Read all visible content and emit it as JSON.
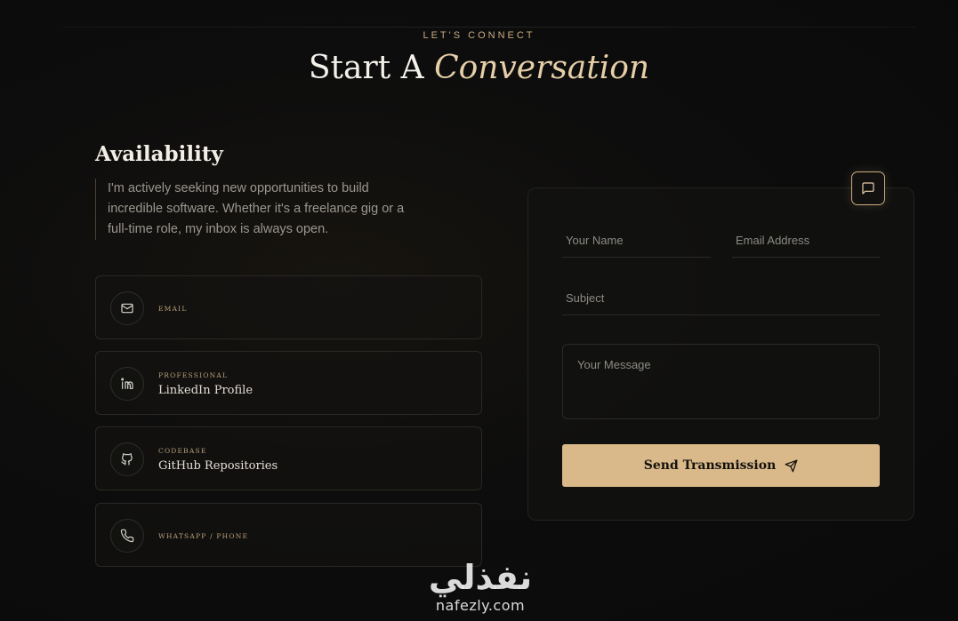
{
  "header": {
    "eyebrow": "LET'S CONNECT",
    "title_main": "Start A",
    "title_accent": "Conversation"
  },
  "availability": {
    "title": "Availability",
    "text": "I'm actively seeking new opportunities to build incredible software. Whether it's a freelance gig or a full-time role, my inbox is always open."
  },
  "contacts": [
    {
      "type": "EMAIL",
      "value": "",
      "icon": "mail-icon"
    },
    {
      "type": "PROFESSIONAL",
      "value": "LinkedIn Profile",
      "icon": "linkedin-icon"
    },
    {
      "type": "CODEBASE",
      "value": "GitHub Repositories",
      "icon": "github-icon"
    },
    {
      "type": "WHATSAPP / PHONE",
      "value": "",
      "icon": "phone-icon"
    }
  ],
  "form": {
    "name_placeholder": "Your Name",
    "email_placeholder": "Email Address",
    "subject_placeholder": "Subject",
    "message_placeholder": "Your Message",
    "send_label": "Send Transmission",
    "badge_icon": "message-square-icon",
    "send_icon": "send-icon"
  },
  "watermark": {
    "arabic": "نفذلي",
    "latin": "nafezly.com"
  },
  "colors": {
    "accent": "#d9b889",
    "gold_text": "#c9ab80",
    "background": "#0d0d0d"
  }
}
